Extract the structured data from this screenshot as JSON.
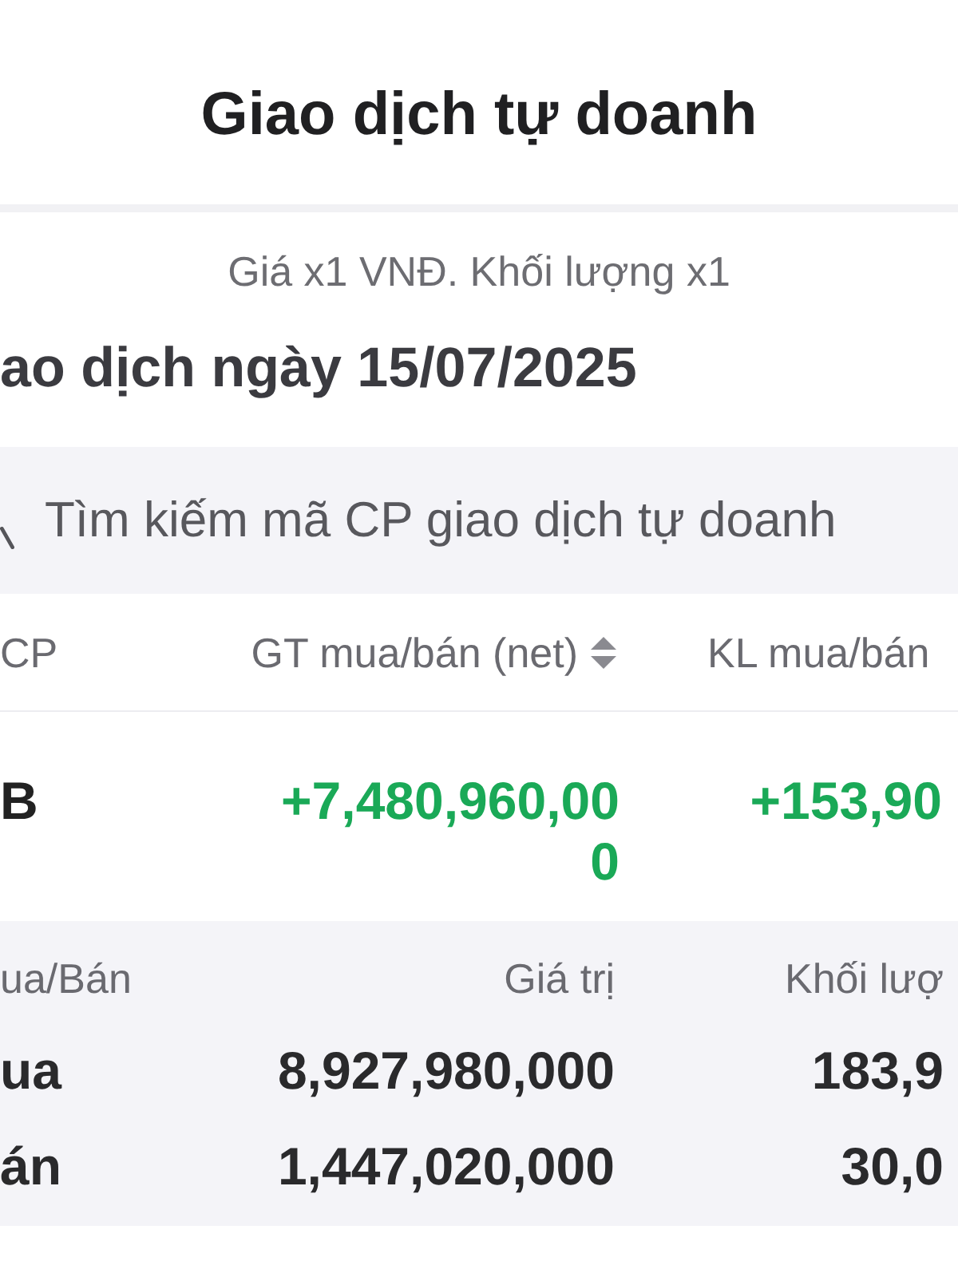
{
  "header": {
    "title": "Giao dịch tự doanh"
  },
  "unit_note": "Giá x1 VNĐ. Khối lượng x1",
  "date_heading": "ao dịch ngày 15/07/2025",
  "search": {
    "placeholder": "Tìm kiếm mã CP giao dịch tự doanh"
  },
  "table": {
    "columns": [
      {
        "label": "CP",
        "sortable": false
      },
      {
        "label": "GT mua/bán (net)",
        "sortable": true
      },
      {
        "label": "KL mua/bán",
        "sortable": false
      }
    ],
    "rows": [
      {
        "ticker": "B",
        "net_value": "+7,480,960,000",
        "net_volume": "+153,90",
        "positive": true
      }
    ]
  },
  "summary": {
    "columns": [
      "ua/Bán",
      "Giá trị",
      "Khối lượ"
    ],
    "rows": [
      {
        "side": "ua",
        "value": "8,927,980,000",
        "volume": "183,9"
      },
      {
        "side": "án",
        "value": "1,447,020,000",
        "volume": "30,0"
      }
    ]
  }
}
